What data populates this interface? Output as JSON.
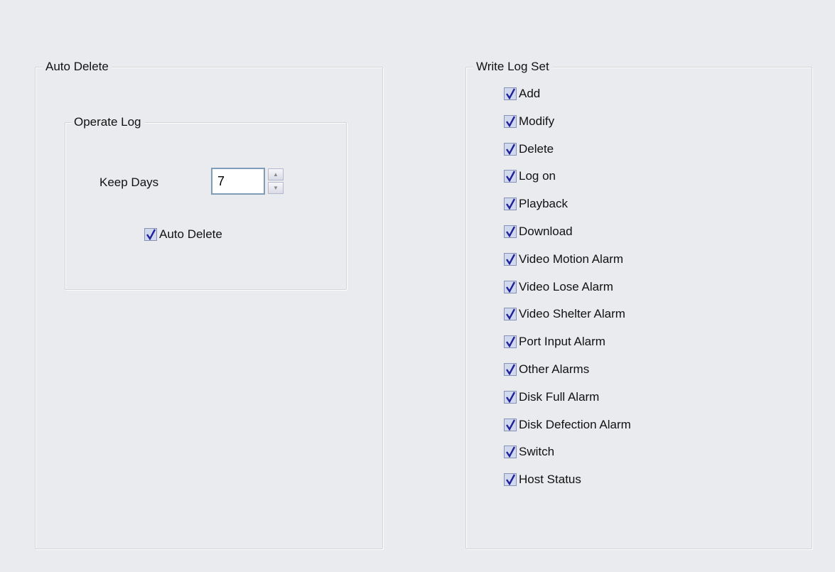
{
  "auto_delete": {
    "title": "Auto Delete",
    "operate_log": {
      "title": "Operate Log",
      "keep_days_label": "Keep Days",
      "keep_days_value": "7",
      "auto_delete_label": "Auto Delete",
      "auto_delete_checked": true
    }
  },
  "write_log_set": {
    "title": "Write Log Set",
    "items": [
      {
        "label": "Add",
        "checked": true
      },
      {
        "label": "Modify",
        "checked": true
      },
      {
        "label": "Delete",
        "checked": true
      },
      {
        "label": "Log on",
        "checked": true
      },
      {
        "label": "Playback",
        "checked": true
      },
      {
        "label": "Download",
        "checked": true
      },
      {
        "label": "Video Motion Alarm",
        "checked": true
      },
      {
        "label": "Video Lose Alarm",
        "checked": true
      },
      {
        "label": "Video Shelter Alarm",
        "checked": true
      },
      {
        "label": "Port Input Alarm",
        "checked": true
      },
      {
        "label": "Other Alarms",
        "checked": true
      },
      {
        "label": "Disk Full Alarm",
        "checked": true
      },
      {
        "label": "Disk Defection Alarm",
        "checked": true
      },
      {
        "label": "Switch",
        "checked": true
      },
      {
        "label": "Host Status",
        "checked": true
      }
    ]
  },
  "icons": {
    "checkbox_checked": "checkmark-icon",
    "spin_up": "triangle-up-icon",
    "spin_down": "triangle-down-icon"
  },
  "colors": {
    "background": "#eaebef",
    "checkbox_fill": "#d1d9ef",
    "checkmark": "#21219a",
    "input_border": "#7f9db9"
  }
}
